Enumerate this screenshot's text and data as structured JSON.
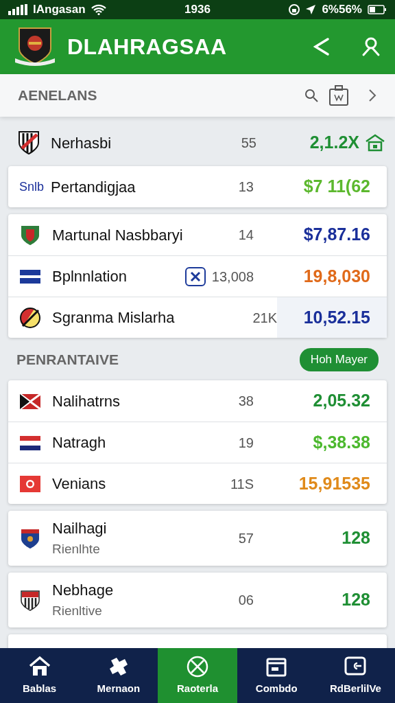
{
  "status_bar": {
    "carrier": "lAngasan",
    "time": "1936",
    "battery": "6%56%"
  },
  "header": {
    "title": "DLAHRAGSAA"
  },
  "section_bar": {
    "title": "AENELANS"
  },
  "top_row": {
    "name": "Nerhasbi",
    "count": "55",
    "value": "2,1.2X",
    "color": "#1f8f34"
  },
  "groups": [
    {
      "rows": [
        {
          "prefix": "Snlb",
          "name": "Pertandigjaa",
          "count": "13",
          "value": "$7 11(62",
          "color": "#5cb82e"
        }
      ]
    },
    {
      "rows": [
        {
          "name": "Martunal Nasbbaryi",
          "count": "14",
          "value": "$7,87.16",
          "color": "#1a2f9a"
        },
        {
          "name": "Bplnnlation",
          "count": "13,008",
          "value": "19,8,030",
          "color": "#e06a1a",
          "badge": true
        },
        {
          "name": "Sgranma Mislarha",
          "count": "21K",
          "value": "10,52.15",
          "color": "#1a2f9a",
          "shaded": true
        }
      ]
    }
  ],
  "section2": {
    "title": "PENRANTAIVE",
    "button": "Hoh Mayer"
  },
  "groups2": [
    {
      "rows": [
        {
          "name": "Nalihatrns",
          "count": "38",
          "value": "2,05.32",
          "color": "#1f8f34"
        },
        {
          "name": "Natragh",
          "count": "19",
          "value": "$,38.38",
          "color": "#4cb82e"
        },
        {
          "name": "Venians",
          "count": "11S",
          "value": "15,91535",
          "color": "#e08a1a"
        }
      ]
    },
    {
      "rows": [
        {
          "name": "Nailhagi",
          "sub": "Rienlhte",
          "count": "57",
          "value": "128",
          "color": "#1f8f34"
        }
      ]
    },
    {
      "rows": [
        {
          "name": "Nebhage",
          "sub": "Rienltive",
          "count": "06",
          "value": "128",
          "color": "#1f8f34"
        }
      ]
    }
  ],
  "bottom_nav": [
    {
      "label": "Bablas",
      "selected": false
    },
    {
      "label": "Mernaon",
      "selected": false
    },
    {
      "label": "Raoterla",
      "selected": true
    },
    {
      "label": "Combdo",
      "selected": false
    },
    {
      "label": "RdBerlilVe",
      "selected": false
    }
  ]
}
